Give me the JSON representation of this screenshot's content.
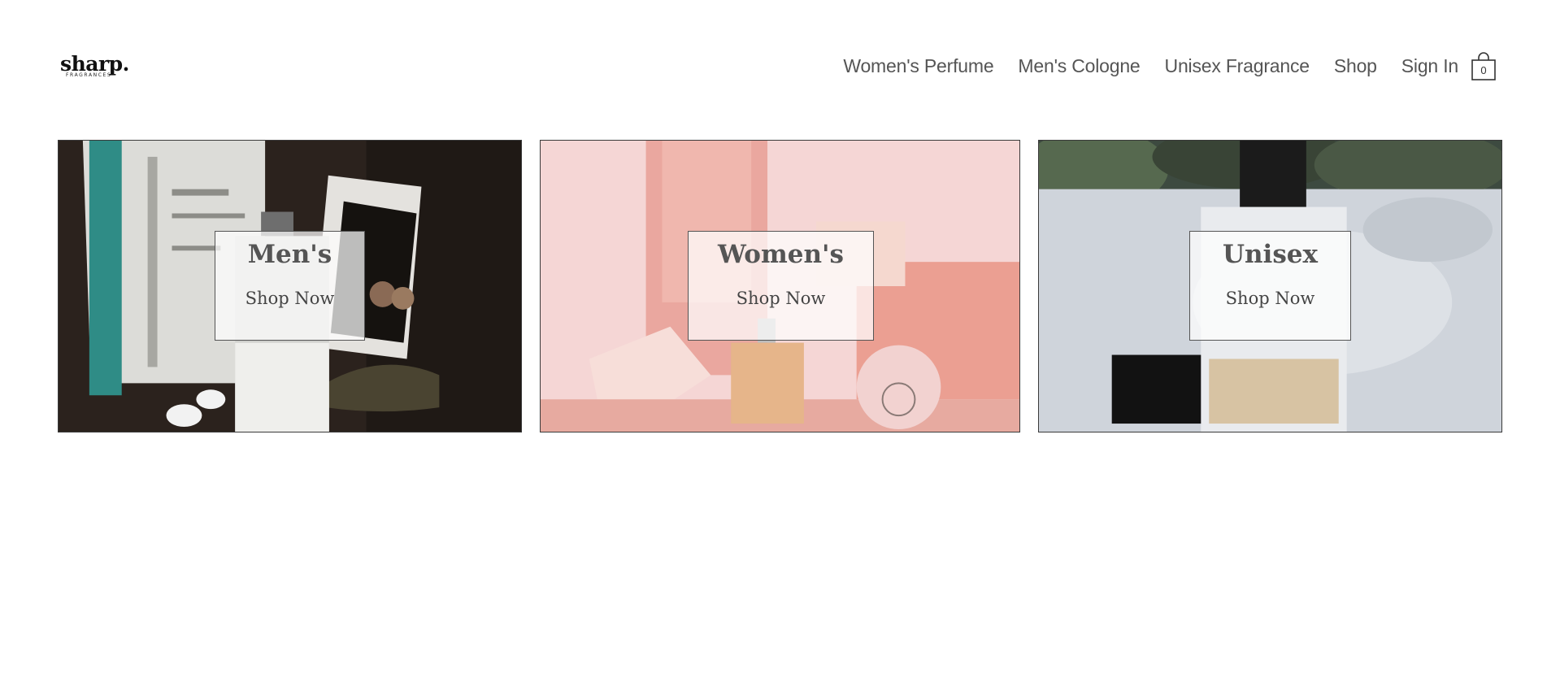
{
  "header": {
    "logo": {
      "main": "sharp.",
      "sub": "FRAGRANCES"
    },
    "nav": [
      {
        "label": "Women's Perfume"
      },
      {
        "label": "Men's Cologne"
      },
      {
        "label": "Unisex Fragrance"
      },
      {
        "label": "Shop"
      },
      {
        "label": "Sign In"
      }
    ],
    "cart": {
      "count": "0",
      "icon": "shopping-bag-icon"
    }
  },
  "categories": [
    {
      "title": "Men's",
      "cta": "Shop Now"
    },
    {
      "title": "Women's",
      "cta": "Shop Now"
    },
    {
      "title": "Unisex",
      "cta": "Shop Now"
    }
  ],
  "colors": {
    "text": "#555555",
    "border": "#3a3a3a",
    "men_bg": "#2a211c",
    "women_bg": "#f3d3d1",
    "unisex_bg": "#c9ced4"
  }
}
